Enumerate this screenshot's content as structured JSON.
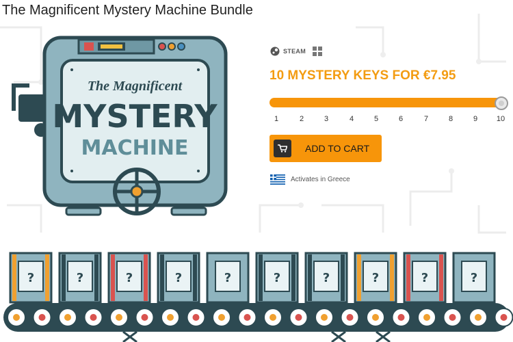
{
  "page_title": "The Magnificent Mystery Machine Bundle",
  "logo": {
    "line1": "The Magnificent",
    "line2": "MYSTERY",
    "line3": "MACHINE"
  },
  "platforms": [
    {
      "icon": "steam-icon",
      "label": "STEAM"
    },
    {
      "icon": "windows-icon",
      "label": ""
    }
  ],
  "offer_text": "10 MYSTERY KEYS FOR €7.95",
  "slider": {
    "selected": 10,
    "ticks": [
      "1",
      "2",
      "3",
      "4",
      "5",
      "6",
      "7",
      "8",
      "9",
      "10"
    ]
  },
  "cart_button": {
    "label": "ADD TO CART",
    "icon": "cart-icon"
  },
  "region": {
    "flag": "greece-flag-icon",
    "text": "Activates in Greece"
  },
  "boxes": [
    "?",
    "?",
    "?",
    "?",
    "?",
    "?",
    "?",
    "?",
    "?",
    "?"
  ],
  "colors": {
    "accent": "#f7950a",
    "machine": "#8fb4bf",
    "dark": "#2d4a52"
  }
}
